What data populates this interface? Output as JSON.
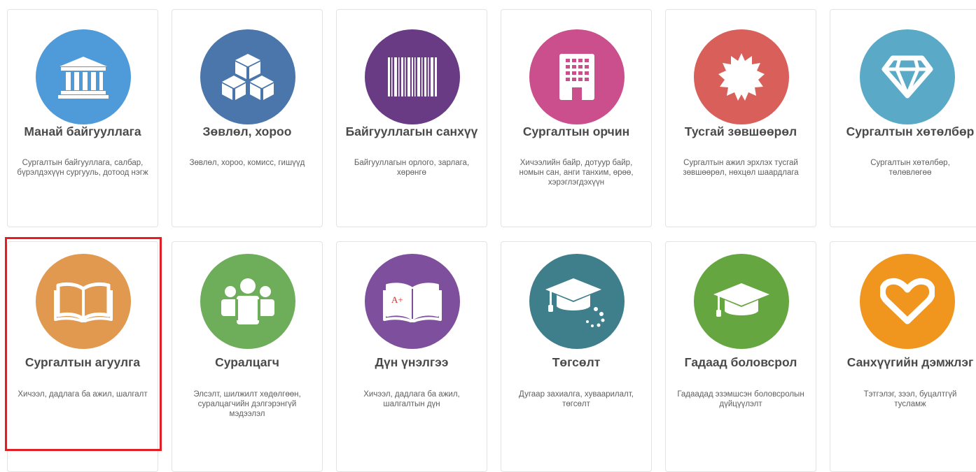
{
  "cards": [
    {
      "title": "Манай байгууллага",
      "desc": "Сургалтын байгууллага, салбар, бүрэлдэхүүн сургууль, дотоод нэгж",
      "icon": "institution-icon",
      "color": "#4f9bd9"
    },
    {
      "title": "Зөвлөл, хороо",
      "desc": "Зөвлөл, хороо, комисс, гишүүд",
      "icon": "cubes-icon",
      "color": "#4a76ab"
    },
    {
      "title": "Байгууллагын санхүү",
      "desc": "Байгууллагын орлого, зарлага, хөрөнгө",
      "icon": "barcode-icon",
      "color": "#6a3b85"
    },
    {
      "title": "Сургалтын орчин",
      "desc": "Хичээлийн байр, дотуур байр, номын сан, анги танхим, өрөө, хэрэглэгдэхүүн",
      "icon": "building-icon",
      "color": "#cc4f8d"
    },
    {
      "title": "Тусгай зөвшөөрөл",
      "desc": "Сургалтын ажил эрхлэх тусгай зөвшөөрөл, нөхцөл шаардлага",
      "icon": "certificate-icon",
      "color": "#d9605a"
    },
    {
      "title": "Сургалтын хөтөлбөр",
      "desc": "Сургалтын хөтөлбөр, төлөвлөгөө",
      "icon": "diamond-icon",
      "color": "#5aa9c7"
    },
    {
      "title": "Сургалтын агуулга",
      "desc": "Хичээл, дадлага ба ажил, шалгалт",
      "icon": "book-open-icon",
      "color": "#e1984f"
    },
    {
      "title": "Суралцагч",
      "desc": "Элсэлт, шилжилт хөдөлгөөн, суралцагчийн дэлгэрэнгүй мэдээлэл",
      "icon": "students-icon",
      "color": "#6eae5b"
    },
    {
      "title": "Дүн үнэлгээ",
      "desc": "Хичээл, дадлага ба ажил, шалгалтын дүн",
      "icon": "grade-book-icon",
      "color": "#7e4f9c"
    },
    {
      "title": "Төгсөлт",
      "desc": "Дугаар захиалга, хуваарилалт, төгсөлт",
      "icon": "graduation-spinner-icon",
      "color": "#3f7f8c"
    },
    {
      "title": "Гадаад боловсрол",
      "desc": "Гадаадад эзэмшсэн боловсролын дүйцүүлэлт",
      "icon": "graduation-cap-icon",
      "color": "#65a640"
    },
    {
      "title": "Санхүүгийн дэмжлэг",
      "desc": "Тэтгэлэг, зээл, буцалтгүй тусламж",
      "icon": "heart-icon",
      "color": "#f0951e"
    }
  ]
}
